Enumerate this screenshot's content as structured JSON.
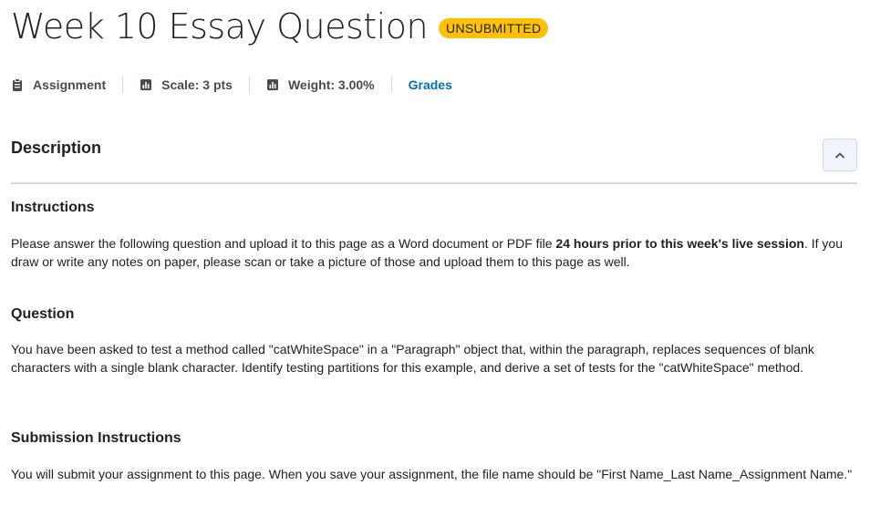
{
  "header": {
    "title": "Week 10 Essay Question",
    "status_badge": "UNSUBMITTED",
    "status_color": "#ffc107"
  },
  "meta": {
    "type_icon": "clipboard-icon",
    "type_label": "Assignment",
    "scale_icon": "chart-icon",
    "scale_label": "Scale: 3 pts",
    "weight_icon": "chart-icon",
    "weight_label": "Weight: 3.00%",
    "grades_link": "Grades",
    "link_color": "#006fbf"
  },
  "description": {
    "title": "Description",
    "collapse_icon": "chevron-up-icon"
  },
  "sections": {
    "instructions": {
      "heading": "Instructions",
      "text_before": "Please answer the following question and upload it to this page as a Word document or PDF file ",
      "text_bold": "24 hours prior to this week's live session",
      "text_after": ". If you draw or write any notes on paper, please scan or take a picture of those and upload them to this page as well."
    },
    "question": {
      "heading": "Question",
      "text": "You have been asked to test a method called \"catWhiteSpace\" in a \"Paragraph\" object that, within the paragraph, replaces sequences of blank characters with a single blank character. Identify testing partitions for this example, and derive a set of tests for the \"catWhiteSpace\" method."
    },
    "submission": {
      "heading": "Submission Instructions",
      "text": "You will submit your assignment to this page. When you save your assignment, the file name should be \"First Name_Last Name_Assignment Name.\""
    }
  }
}
